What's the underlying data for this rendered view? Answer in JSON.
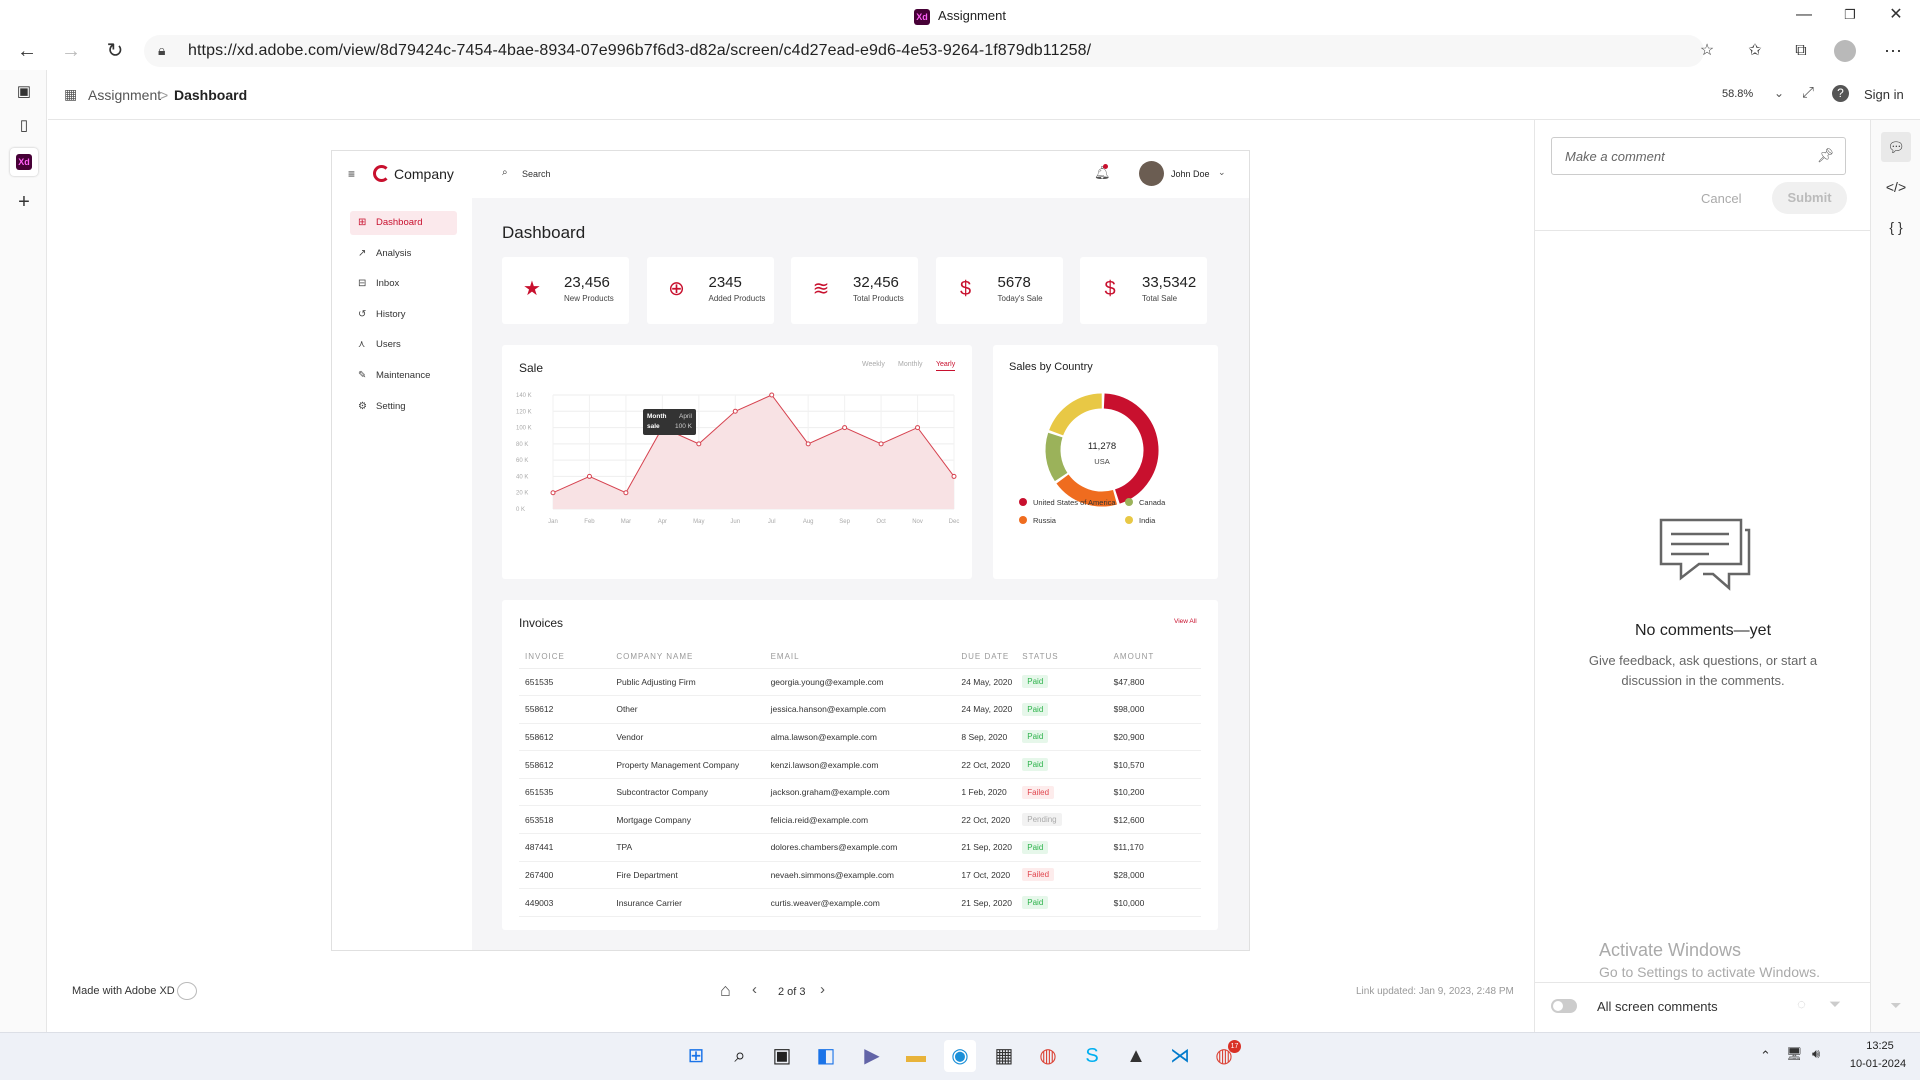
{
  "browser": {
    "window_title": "Assignment",
    "xd_badge": "Xd",
    "url": "https://xd.adobe.com/view/8d79424c-7454-4bae-8934-07e996b7f6d3-d82a/screen/c4d27ead-e9d6-4e53-9264-1f879db11258/"
  },
  "xd_header": {
    "breadcrumb_root": "Assignment",
    "breadcrumb_sep": ">",
    "breadcrumb_current": "Dashboard",
    "zoom": "58.8%",
    "sign_in": "Sign in"
  },
  "app": {
    "brand": "Company",
    "search_label": "Search",
    "user_name": "John Doe",
    "page_title": "Dashboard",
    "nav": [
      {
        "label": "Dashboard",
        "icon": "grid-icon",
        "glyph": "⊞"
      },
      {
        "label": "Analysis",
        "icon": "analysis-icon",
        "glyph": "↗"
      },
      {
        "label": "Inbox",
        "icon": "inbox-icon",
        "glyph": "⊟"
      },
      {
        "label": "History",
        "icon": "history-icon",
        "glyph": "↺"
      },
      {
        "label": "Users",
        "icon": "users-icon",
        "glyph": "⋏"
      },
      {
        "label": "Maintenance",
        "icon": "maintenance-icon",
        "glyph": "✎"
      },
      {
        "label": "Setting",
        "icon": "gear-icon",
        "glyph": "⚙"
      }
    ],
    "stats": [
      {
        "value": "23,456",
        "label": "New Products",
        "glyph": "★",
        "icon": "star-icon"
      },
      {
        "value": "2345",
        "label": "Added Products",
        "glyph": "⊕",
        "icon": "add-box-icon"
      },
      {
        "value": "32,456",
        "label": "Total Products",
        "glyph": "≋",
        "icon": "layers-icon"
      },
      {
        "value": "5678",
        "label": "Today's Sale",
        "glyph": "$",
        "icon": "dollar-icon"
      },
      {
        "value": "33,5342",
        "label": "Total Sale",
        "glyph": "$",
        "icon": "money-bag-icon"
      }
    ],
    "sale": {
      "title": "Sale",
      "tabs": [
        "Weekly",
        "Monthly",
        "Yearly"
      ],
      "active_tab": "Yearly",
      "tooltip": {
        "k1": "Month",
        "v1": "April",
        "k2": "sale",
        "v2": "100 K"
      }
    },
    "country": {
      "title": "Sales by Country",
      "center_value": "11,278",
      "center_label": "USA",
      "legend": [
        {
          "label": "United States of America",
          "color": "#c8102e"
        },
        {
          "label": "Canada",
          "color": "#9bb25a"
        },
        {
          "label": "Russia",
          "color": "#ef6c1f"
        },
        {
          "label": "India",
          "color": "#e8c845"
        }
      ]
    },
    "invoices": {
      "title": "Invoices",
      "view_all": "View All",
      "columns": [
        "INVOICE",
        "COMPANY NAME",
        "EMAIL",
        "DUE DATE",
        "STATUS",
        "AMOUNT"
      ],
      "rows": [
        [
          "651535",
          "Public Adjusting Firm",
          "georgia.young@example.com",
          "24 May, 2020",
          "Paid",
          "$47,800"
        ],
        [
          "558612",
          "Other",
          "jessica.hanson@example.com",
          "24 May, 2020",
          "Paid",
          "$98,000"
        ],
        [
          "558612",
          "Vendor",
          "alma.lawson@example.com",
          "8 Sep, 2020",
          "Paid",
          "$20,900"
        ],
        [
          "558612",
          "Property Management Company",
          "kenzi.lawson@example.com",
          "22 Oct, 2020",
          "Paid",
          "$10,570"
        ],
        [
          "651535",
          "Subcontractor Company",
          "jackson.graham@example.com",
          "1 Feb, 2020",
          "Failed",
          "$10,200"
        ],
        [
          "653518",
          "Mortgage Company",
          "felicia.reid@example.com",
          "22 Oct, 2020",
          "Pending",
          "$12,600"
        ],
        [
          "487441",
          "TPA",
          "dolores.chambers@example.com",
          "21 Sep, 2020",
          "Paid",
          "$11,170"
        ],
        [
          "267400",
          "Fire Department",
          "nevaeh.simmons@example.com",
          "17 Oct, 2020",
          "Failed",
          "$28,000"
        ],
        [
          "449003",
          "Insurance Carrier",
          "curtis.weaver@example.com",
          "21 Sep, 2020",
          "Paid",
          "$10,000"
        ]
      ]
    }
  },
  "chart_data": [
    {
      "type": "area",
      "title": "Sale",
      "categories": [
        "Jan",
        "Feb",
        "Mar",
        "Apr",
        "May",
        "Jun",
        "Jul",
        "Aug",
        "Sep",
        "Oct",
        "Nov",
        "Dec"
      ],
      "values": [
        20,
        40,
        20,
        100,
        80,
        120,
        140,
        80,
        100,
        80,
        100,
        40
      ],
      "ytick_labels": [
        "0 K",
        "20 K",
        "40 K",
        "60 K",
        "80 K",
        "100 K",
        "120 K",
        "140 K"
      ],
      "ylim": [
        0,
        140
      ],
      "grid": true,
      "color": "#d6424f"
    },
    {
      "type": "pie",
      "title": "Sales by Country",
      "labels": [
        "United States of America",
        "Russia",
        "Canada",
        "India"
      ],
      "values": [
        45,
        20,
        15,
        20
      ],
      "colors": [
        "#c8102e",
        "#ef6c1f",
        "#9bb25a",
        "#e8c845"
      ]
    }
  ],
  "comments": {
    "placeholder": "Make a comment",
    "cancel": "Cancel",
    "submit": "Submit",
    "empty_title": "No comments—yet",
    "empty_body": "Give feedback, ask questions, or start a discussion in the comments.",
    "all_screen_comments": "All screen comments"
  },
  "footer": {
    "made_with": "Made with Adobe XD",
    "pager": "2 of 3",
    "link_updated": "Link updated: Jan 9, 2023, 2:48 PM"
  },
  "watermark": {
    "line1": "Activate Windows",
    "line2": "Go to Settings to activate Windows."
  },
  "taskbar": {
    "time": "13:25",
    "date": "10-01-2024",
    "chrome_badge": "17"
  }
}
